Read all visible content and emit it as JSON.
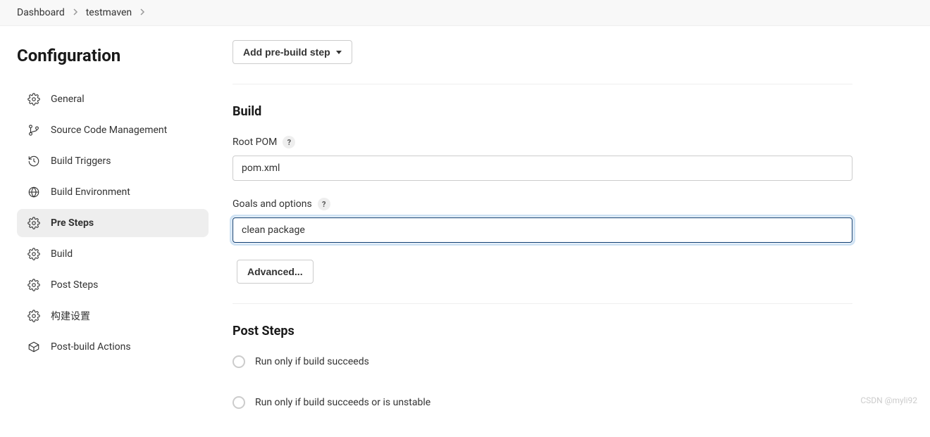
{
  "breadcrumb": {
    "items": [
      "Dashboard",
      "testmaven"
    ]
  },
  "sidebar": {
    "title": "Configuration",
    "items": [
      {
        "label": "General",
        "icon": "gear"
      },
      {
        "label": "Source Code Management",
        "icon": "branch"
      },
      {
        "label": "Build Triggers",
        "icon": "history"
      },
      {
        "label": "Build Environment",
        "icon": "globe"
      },
      {
        "label": "Pre Steps",
        "icon": "gear",
        "active": true
      },
      {
        "label": "Build",
        "icon": "gear"
      },
      {
        "label": "Post Steps",
        "icon": "gear"
      },
      {
        "label": "构建设置",
        "icon": "gear"
      },
      {
        "label": "Post-build Actions",
        "icon": "package"
      }
    ]
  },
  "prebuild": {
    "button_label": "Add pre-build step"
  },
  "build": {
    "title": "Build",
    "root_pom": {
      "label": "Root POM",
      "value": "pom.xml",
      "help": "?"
    },
    "goals": {
      "label": "Goals and options",
      "value": "clean package",
      "help": "?"
    },
    "advanced_label": "Advanced..."
  },
  "post_steps": {
    "title": "Post Steps",
    "options": [
      "Run only if build succeeds",
      "Run only if build succeeds or is unstable"
    ]
  },
  "watermark": "CSDN @myli92"
}
